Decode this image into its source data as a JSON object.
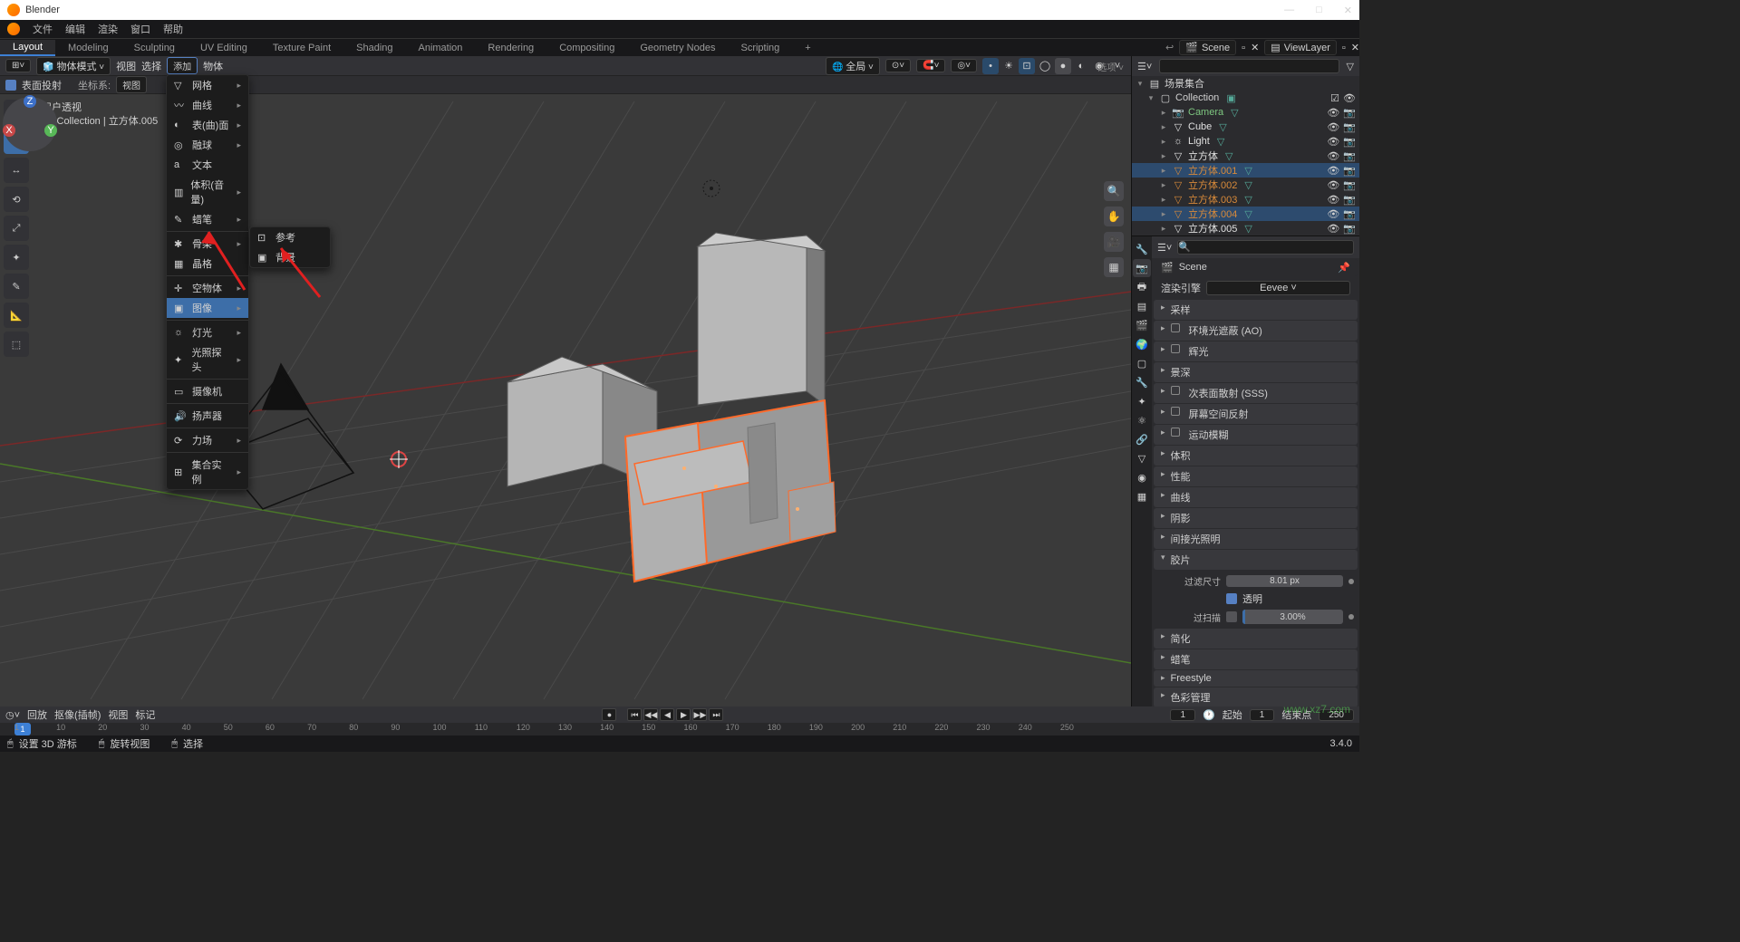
{
  "app": {
    "title": "Blender"
  },
  "window": {
    "min": "—",
    "max": "□",
    "close": "✕"
  },
  "menubar": [
    "文件",
    "编辑",
    "渲染",
    "窗口",
    "帮助"
  ],
  "tabs": [
    "Layout",
    "Modeling",
    "Sculpting",
    "UV Editing",
    "Texture Paint",
    "Shading",
    "Animation",
    "Rendering",
    "Compositing",
    "Geometry Nodes",
    "Scripting"
  ],
  "scene": {
    "label": "Scene",
    "viewlayer": "ViewLayer"
  },
  "vhdr": {
    "mode": "物体模式",
    "view": "视图",
    "select": "选择",
    "add": "添加",
    "object": "物体",
    "orient": "全局",
    "options": "选项 ˅",
    "checklabel": "表面投射",
    "coord_label": "坐标系:",
    "coord": "视图"
  },
  "overlay": {
    "l1": "用户透视",
    "l2": "(1) Collection | 立方体.005"
  },
  "addmenu": {
    "items": [
      {
        "icon": "▽",
        "label": "网格",
        "sub": true
      },
      {
        "icon": "〰",
        "label": "曲线",
        "sub": true
      },
      {
        "icon": "◐",
        "label": "表(曲)面",
        "sub": true
      },
      {
        "icon": "◎",
        "label": "融球",
        "sub": true
      },
      {
        "icon": "a",
        "label": "文本"
      },
      {
        "icon": "▥",
        "label": "体积(音量)",
        "sub": true
      },
      {
        "icon": "✎",
        "label": "蜡笔",
        "sub": true
      },
      {
        "sep": true
      },
      {
        "icon": "✱",
        "label": "骨架",
        "sub": true
      },
      {
        "icon": "▦",
        "label": "晶格"
      },
      {
        "sep": true
      },
      {
        "icon": "✛",
        "label": "空物体",
        "sub": true
      },
      {
        "icon": "▣",
        "label": "图像",
        "sub": true,
        "hl": true
      },
      {
        "sep": true
      },
      {
        "icon": "☼",
        "label": "灯光",
        "sub": true
      },
      {
        "icon": "✦",
        "label": "光照探头",
        "sub": true
      },
      {
        "sep": true
      },
      {
        "icon": "▭",
        "label": "摄像机"
      },
      {
        "sep": true
      },
      {
        "icon": "🔊",
        "label": "扬声器"
      },
      {
        "sep": true
      },
      {
        "icon": "⟳",
        "label": "力场",
        "sub": true
      },
      {
        "sep": true
      },
      {
        "icon": "⊞",
        "label": "集合实例",
        "sub": true
      }
    ]
  },
  "subimg": {
    "items": [
      {
        "icon": "⊡",
        "label": "参考"
      },
      {
        "icon": "▣",
        "label": "背景"
      }
    ]
  },
  "outliner": {
    "header": "场景集合",
    "root": "Collection",
    "items": [
      {
        "icon": "📷",
        "label": "Camera",
        "color": "#7ec780"
      },
      {
        "icon": "▽",
        "label": "Cube",
        "color": "#e0e0e0"
      },
      {
        "icon": "☼",
        "label": "Light",
        "color": "#e0e0e0"
      },
      {
        "icon": "▽",
        "label": "立方体",
        "color": "#e0e0e0"
      },
      {
        "icon": "▽",
        "label": "立方体.001",
        "color": "#d88a3a",
        "sel": true
      },
      {
        "icon": "▽",
        "label": "立方体.002",
        "color": "#d88a3a"
      },
      {
        "icon": "▽",
        "label": "立方体.003",
        "color": "#d88a3a"
      },
      {
        "icon": "▽",
        "label": "立方体.004",
        "color": "#d88a3a",
        "sel": true
      },
      {
        "icon": "▽",
        "label": "立方体.005",
        "color": "#e0e0e0"
      }
    ]
  },
  "props": {
    "scene": "Scene",
    "engine_label": "渲染引擎",
    "engine": "Eevee",
    "panels": [
      "采样",
      "环境光遮蔽 (AO)",
      "辉光",
      "景深",
      "次表面散射 (SSS)",
      "屏幕空间反射",
      "运动模糊",
      "体积",
      "性能",
      "曲线",
      "阴影",
      "间接光照明",
      "胶片",
      "简化",
      "蜡笔",
      "Freestyle",
      "色彩管理"
    ],
    "film": {
      "filter_label": "过滤尺寸",
      "filter": "8.01 px",
      "transparent_label": "透明",
      "transparent": true,
      "overscan_label": "过扫描",
      "overscan": "3.00%"
    }
  },
  "timeline": {
    "playback": "回放",
    "keying": "抠像(插帧)",
    "view": "视图",
    "marker": "标记",
    "cur": "1",
    "start_label": "起始",
    "start": "1",
    "end_label": "结束点",
    "end": "250",
    "ticks": [
      "1",
      "10",
      "20",
      "30",
      "40",
      "50",
      "60",
      "70",
      "80",
      "90",
      "100",
      "110",
      "120",
      "130",
      "140",
      "150",
      "160",
      "170",
      "180",
      "190",
      "200",
      "210",
      "220",
      "230",
      "240",
      "250"
    ]
  },
  "status": {
    "a": "设置 3D 游标",
    "b": "旋转视图",
    "c": "选择"
  },
  "version": "3.4.0",
  "wm": "www.xz7.com"
}
